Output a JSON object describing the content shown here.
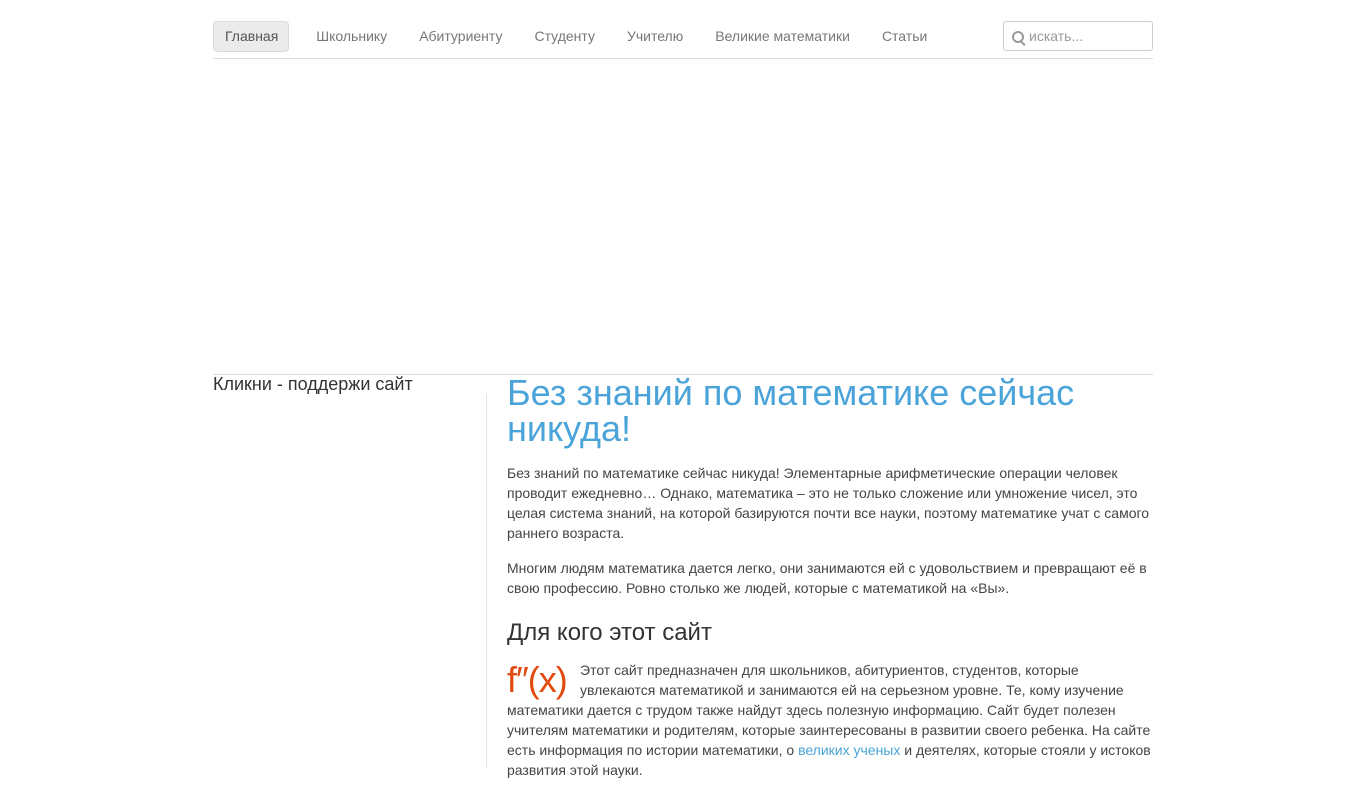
{
  "nav": {
    "items": [
      {
        "label": "Главная",
        "active": true
      },
      {
        "label": "Школьнику",
        "active": false
      },
      {
        "label": "Абитуриенту",
        "active": false
      },
      {
        "label": "Студенту",
        "active": false
      },
      {
        "label": "Учителю",
        "active": false
      },
      {
        "label": "Великие математики",
        "active": false
      },
      {
        "label": "Статьи",
        "active": false
      }
    ],
    "search_placeholder": "искать..."
  },
  "sidebar": {
    "title": "Кликни - поддержи сайт"
  },
  "main": {
    "title": "Без знаний по математике сейчас никуда!",
    "para1": "Без знаний по математике сейчас никуда! Элементарные арифметические операции человек проводит ежедневно… Однако, математика – это не только сложение или умножение чисел, это целая система знаний, на которой базируются почти все науки, поэтому математике учат с самого раннего возраста.",
    "para2": "Многим людям математика дается легко, они занимаются ей с удовольствием и превращают её в свою профессию. Ровно столько же людей, которые с математикой на «Вы».",
    "section_title": "Для кого этот сайт",
    "logo_text": "f″(x)",
    "para3_before_link": "Этот сайт предназначен для школьников, абитуриентов, студентов, которые увлекаются математикой и занимаются ей на серьезном уровне. Те, кому изучение математики дается с трудом также найдут здесь полезную информацию. Сайт будет полезен учителям математики и родителям, которые заинтересованы в развитии своего ребенка. На сайте есть информация по истории математики, о ",
    "para3_link": "великих ученых",
    "para3_after_link": " и деятелях, которые стояли у истоков развития этой науки."
  },
  "colors": {
    "accent": "#4aa3d9",
    "logo": "#e24a10",
    "nav_active_bg": "#ebebeb"
  }
}
